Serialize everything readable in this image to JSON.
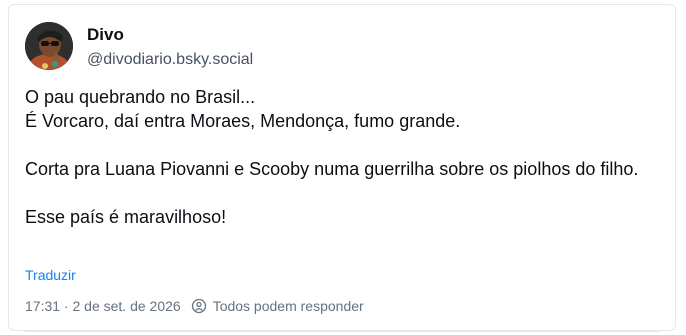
{
  "author": {
    "name": "Divo",
    "handle": "@divodiario.bsky.social"
  },
  "post": {
    "line1": "O pau quebrando no Brasil...",
    "line2": "É Vorcaro, daí entra Moraes, Mendonça, fumo grande.",
    "line3": "Corta pra Luana Piovanni e Scooby numa guerrilha sobre os piolhos do filho.",
    "line4": "Esse país é maravilhoso!"
  },
  "actions": {
    "translate_label": "Traduzir"
  },
  "meta": {
    "timestamp": "17:31 · 2 de set. de 2026",
    "reply_setting": "Todos podem responder"
  },
  "colors": {
    "link": "#1083fe",
    "muted": "#66727f"
  },
  "icons": {
    "reply_setting": "globe-people-icon"
  }
}
